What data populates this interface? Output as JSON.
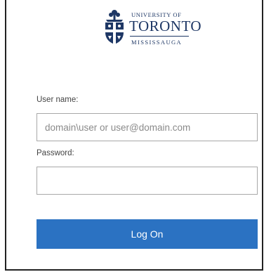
{
  "logo": {
    "line1": "UNIVERSITY OF",
    "line2": "TORONTO",
    "line3": "MISSISSAUGA"
  },
  "form": {
    "username_label": "User name:",
    "username_placeholder": "domain\\user or user@domain.com",
    "username_value": "",
    "password_label": "Password:",
    "password_value": "",
    "submit_label": "Log On"
  },
  "colors": {
    "brand_navy": "#1e3765",
    "button_blue": "#2b72c2"
  },
  "icons": {
    "crest": "university-crest-icon"
  }
}
